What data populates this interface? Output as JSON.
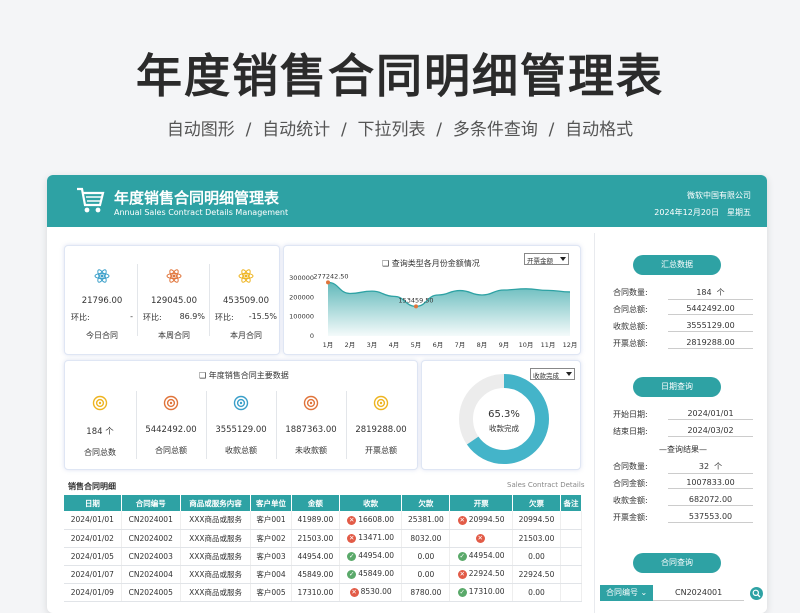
{
  "hero": {
    "title": "年度销售合同明细管理表",
    "features": "自动图形  /  自动统计  /  下拉列表  /  多条件查询  /  自动格式"
  },
  "header": {
    "title": "年度销售合同明细管理表",
    "subtitle": "Annual Sales Contract Details Management",
    "company": "微软中国有限公司",
    "date": "2024年12月20日",
    "weekday": "星期五"
  },
  "kpis": [
    {
      "value": "21796.00",
      "ratio_label": "环比:",
      "ratio": "-",
      "label": "今日合同"
    },
    {
      "value": "129045.00",
      "ratio_label": "环比:",
      "ratio": "86.9%",
      "label": "本周合同"
    },
    {
      "value": "453509.00",
      "ratio_label": "环比:",
      "ratio": "-15.5%",
      "label": "本月合同"
    }
  ],
  "line_chart": {
    "title": "❑ 查询类型各月份金额情况",
    "selector": "开票金额"
  },
  "chart_data": {
    "type": "area",
    "title": "❑ 查询类型各月份金额情况",
    "categories": [
      "1月",
      "2月",
      "3月",
      "4月",
      "5月",
      "6月",
      "7月",
      "8月",
      "9月",
      "10月",
      "11月",
      "12月"
    ],
    "series": [
      {
        "values": [
          277242.5,
          220000,
          232000,
          205000,
          153459.5,
          212000,
          235000,
          212000,
          238000,
          244000,
          236000,
          228000
        ]
      }
    ],
    "yticks": [
      "300000",
      "200000",
      "100000",
      "0"
    ],
    "ylim": [
      0,
      300000
    ],
    "annotations": [
      "277242.50",
      "153459.50"
    ]
  },
  "main_stats": {
    "title": "❑ 年度销售合同主要数据",
    "items": [
      {
        "value": "184 个",
        "label": "合同总数"
      },
      {
        "value": "5442492.00",
        "label": "合同总额"
      },
      {
        "value": "3555129.00",
        "label": "收款总额"
      },
      {
        "value": "1887363.00",
        "label": "未收款额"
      },
      {
        "value": "2819288.00",
        "label": "开票总额"
      }
    ]
  },
  "donut": {
    "selector": "收款完成",
    "percent": "65.3%",
    "label": "收款完成",
    "fraction": 0.653
  },
  "table": {
    "title": "销售合同明细",
    "title_en": "Sales Contract Details",
    "columns": [
      "日期",
      "合同编号",
      "商品或服务内容",
      "客户单位",
      "金额",
      "收款",
      "欠款",
      "开票",
      "欠票",
      "备注"
    ],
    "rows": [
      {
        "date": "2024/01/01",
        "no": "CN2024001",
        "item": "XXX商品或服务",
        "client": "客户001",
        "amount": "41989.00",
        "recv_status": "x",
        "recv": "16608.00",
        "debt": "25381.00",
        "inv_status": "x",
        "inv": "20994.50",
        "owe": "20994.50",
        "note": ""
      },
      {
        "date": "2024/01/02",
        "no": "CN2024002",
        "item": "XXX商品或服务",
        "client": "客户002",
        "amount": "21503.00",
        "recv_status": "x",
        "recv": "13471.00",
        "debt": "8032.00",
        "inv_status": "x",
        "inv": "",
        "owe": "21503.00",
        "note": ""
      },
      {
        "date": "2024/01/05",
        "no": "CN2024003",
        "item": "XXX商品或服务",
        "client": "客户003",
        "amount": "44954.00",
        "recv_status": "ok",
        "recv": "44954.00",
        "debt": "0.00",
        "inv_status": "ok",
        "inv": "44954.00",
        "owe": "0.00",
        "note": ""
      },
      {
        "date": "2024/01/07",
        "no": "CN2024004",
        "item": "XXX商品或服务",
        "client": "客户004",
        "amount": "45849.00",
        "recv_status": "ok",
        "recv": "45849.00",
        "debt": "0.00",
        "inv_status": "x",
        "inv": "22924.50",
        "owe": "22924.50",
        "note": ""
      },
      {
        "date": "2024/01/09",
        "no": "CN2024005",
        "item": "XXX商品或服务",
        "client": "客户005",
        "amount": "17310.00",
        "recv_status": "x",
        "recv": "8530.00",
        "debt": "8780.00",
        "inv_status": "ok",
        "inv": "17310.00",
        "owe": "0.00",
        "note": ""
      }
    ]
  },
  "sidebar": {
    "summary": {
      "title": "汇总数据",
      "rows": [
        {
          "k": "合同数量:",
          "v": "184  个"
        },
        {
          "k": "合同总额:",
          "v": "5442492.00"
        },
        {
          "k": "收款总额:",
          "v": "3555129.00"
        },
        {
          "k": "开票总额:",
          "v": "2819288.00"
        }
      ]
    },
    "date_query": {
      "title": "日期查询",
      "start_label": "开始日期:",
      "start": "2024/01/01",
      "end_label": "结束日期:",
      "end": "2024/03/02",
      "hint": "—查询结果—",
      "rows": [
        {
          "k": "合同数量:",
          "v": "32  个"
        },
        {
          "k": "合同金额:",
          "v": "1007833.00"
        },
        {
          "k": "收款金额:",
          "v": "682072.00"
        },
        {
          "k": "开票金额:",
          "v": "537553.00"
        }
      ]
    },
    "contract_query": {
      "title": "合同查询",
      "field": "合同编号",
      "value": "CN2024001"
    }
  },
  "colors": {
    "accent": "#2ea2a4",
    "kpi_blue": "#3a9fc9",
    "kpi_orange": "#e0743a",
    "kpi_yellow": "#eeb420",
    "red": "#e25b47",
    "green": "#5aa96a"
  }
}
